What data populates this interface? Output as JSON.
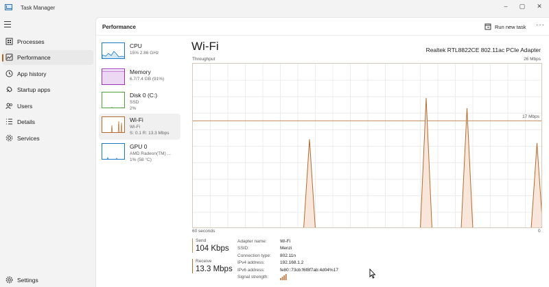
{
  "app": {
    "title": "Task Manager"
  },
  "window_controls": {
    "minimize": "–",
    "maximize": "▢",
    "close": "✕"
  },
  "nav": {
    "items": [
      {
        "label": "Processes",
        "icon": "processes-icon"
      },
      {
        "label": "Performance",
        "icon": "performance-icon"
      },
      {
        "label": "App history",
        "icon": "app-history-icon"
      },
      {
        "label": "Startup apps",
        "icon": "startup-apps-icon"
      },
      {
        "label": "Users",
        "icon": "users-icon"
      },
      {
        "label": "Details",
        "icon": "details-icon"
      },
      {
        "label": "Services",
        "icon": "services-icon"
      }
    ],
    "settings_label": "Settings",
    "active": "Performance"
  },
  "header": {
    "title": "Performance",
    "run_new_task": "Run new task",
    "more": "···"
  },
  "perf_list": [
    {
      "name": "CPU",
      "sub1": "15% 2.86 GHz",
      "sub2": "",
      "color": "#1979c4"
    },
    {
      "name": "Memory",
      "sub1": "6.7/7.4 GB (91%)",
      "sub2": "",
      "color": "#9b31b8"
    },
    {
      "name": "Disk 0 (C:)",
      "sub1": "SSD",
      "sub2": "2%",
      "color": "#4ca437"
    },
    {
      "name": "Wi-Fi",
      "sub1": "Wi-Fi",
      "sub2": "S: 0.1 R: 13.3 Mbps",
      "color": "#b66a2a"
    },
    {
      "name": "GPU 0",
      "sub1": "AMD Radeon(TM) ...",
      "sub2": "1% (58 °C)",
      "color": "#1979c4"
    }
  ],
  "detail": {
    "title": "Wi-Fi",
    "adapter": "Realtek RTL8822CE 802.11ac PCIe Adapter",
    "throughput_label": "Throughput",
    "max_label": "26 Mbps",
    "mid_label": "17 Mbps",
    "time_label": "60 seconds",
    "zero_label": "0",
    "send": {
      "label": "Send",
      "value": "104 Kbps",
      "color": "#c48a57"
    },
    "receive": {
      "label": "Receive",
      "value": "13.3 Mbps",
      "color": "#b66a2a"
    },
    "properties": [
      {
        "label": "Adapter name:",
        "value": "Wi-Fi"
      },
      {
        "label": "SSID:",
        "value": "Menzi"
      },
      {
        "label": "Connection type:",
        "value": "802.11n"
      },
      {
        "label": "IPv4 address:",
        "value": "192.168.1.2"
      },
      {
        "label": "IPv6 address:",
        "value": "fe80::73cb:f6f8f7ab:4d04%17"
      },
      {
        "label": "Signal strength:",
        "value": ""
      }
    ],
    "signal_bars": 4
  },
  "chart_data": {
    "type": "area",
    "ylabel": "Throughput",
    "ylim": [
      0,
      26
    ],
    "x_range_seconds": 60,
    "scale_line_value": 17,
    "series": [
      {
        "values": [
          0,
          0,
          0,
          0,
          0,
          0,
          0,
          0,
          0,
          0,
          0,
          0,
          0,
          0,
          0,
          0,
          0,
          0,
          0,
          0,
          0,
          0,
          0,
          0,
          0,
          0,
          0,
          0,
          0,
          0,
          0,
          0,
          0,
          0,
          0,
          0,
          0,
          0,
          0,
          0,
          0,
          0,
          0,
          0,
          0,
          0,
          0,
          0,
          0,
          0,
          0,
          0,
          0,
          0,
          0,
          0,
          0,
          0,
          0,
          0,
          0
        ]
      },
      {
        "values": [
          0,
          0,
          0,
          0,
          0,
          0,
          0,
          0,
          0,
          0,
          0,
          0,
          0,
          0,
          0,
          0,
          0,
          0,
          0,
          0,
          0,
          0,
          0,
          0,
          0,
          0,
          0,
          0,
          0,
          0,
          0,
          0,
          0,
          0,
          0,
          0,
          0,
          0,
          0,
          0,
          0,
          0,
          0,
          0,
          0,
          0,
          0,
          0,
          0,
          0,
          0,
          0,
          0,
          0,
          0,
          0,
          0,
          0,
          0,
          0,
          0
        ]
      }
    ],
    "spikes": [
      {
        "t": 20,
        "value": 14.1
      },
      {
        "t": 40,
        "value": 20.6
      },
      {
        "t": 47,
        "value": 19.0
      },
      {
        "t": 59,
        "value": 13.5
      }
    ],
    "colors": {
      "line": "#b66a2a",
      "fill": "#f7e6d9",
      "grid": "#ececec"
    }
  }
}
